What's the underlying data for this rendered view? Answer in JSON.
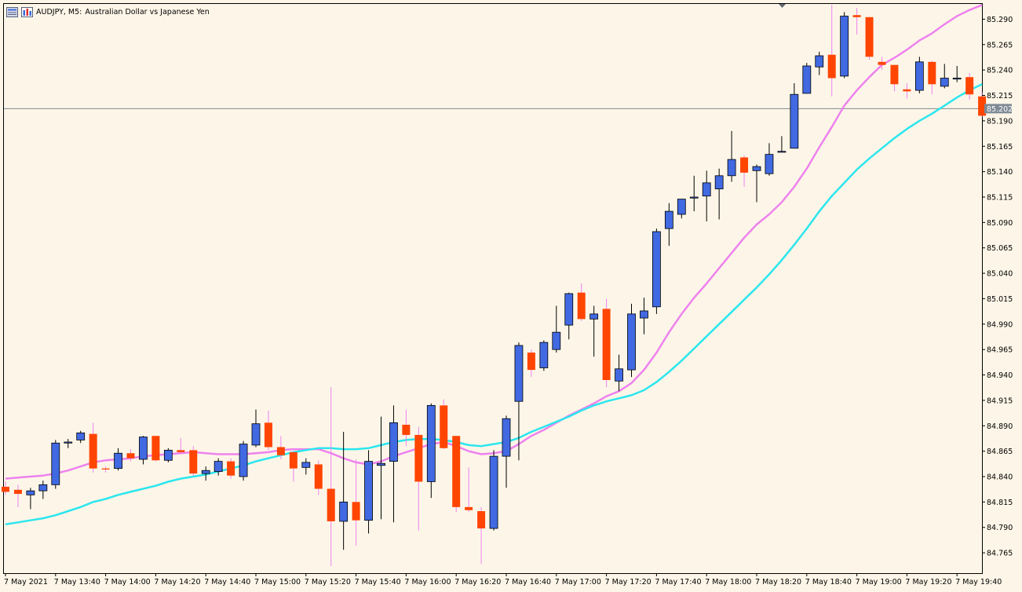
{
  "header": {
    "symbol_period": "AUDJPY, M5:",
    "description": "Australian Dollar vs Japanese Yen"
  },
  "price_line": {
    "value": 85.202,
    "label": "85.202"
  },
  "chart_data": {
    "type": "candlestick",
    "symbol": "AUDJPY",
    "timeframe": "M5",
    "title": "Australian Dollar vs Japanese Yen",
    "ylim": [
      84.745,
      85.305
    ],
    "y_ticks": [
      "85.290",
      "85.265",
      "85.240",
      "85.215",
      "85.190",
      "85.165",
      "85.140",
      "85.115",
      "85.090",
      "85.065",
      "85.040",
      "85.015",
      "84.990",
      "84.965",
      "84.940",
      "84.915",
      "84.890",
      "84.865",
      "84.840",
      "84.815",
      "84.790",
      "84.765"
    ],
    "x_ticks": [
      {
        "label": "7 May 2021",
        "i": 0
      },
      {
        "label": "7 May 13:40",
        "i": 4
      },
      {
        "label": "7 May 14:00",
        "i": 8
      },
      {
        "label": "7 May 14:20",
        "i": 12
      },
      {
        "label": "7 May 14:40",
        "i": 16
      },
      {
        "label": "7 May 15:00",
        "i": 20
      },
      {
        "label": "7 May 15:20",
        "i": 24
      },
      {
        "label": "7 May 15:40",
        "i": 28
      },
      {
        "label": "7 May 16:00",
        "i": 32
      },
      {
        "label": "7 May 16:20",
        "i": 36
      },
      {
        "label": "7 May 16:40",
        "i": 40
      },
      {
        "label": "7 May 17:00",
        "i": 44
      },
      {
        "label": "7 May 17:20",
        "i": 48
      },
      {
        "label": "7 May 17:40",
        "i": 52
      },
      {
        "label": "7 May 18:00",
        "i": 56
      },
      {
        "label": "7 May 18:20",
        "i": 60
      },
      {
        "label": "7 May 18:40",
        "i": 64
      },
      {
        "label": "7 May 19:00",
        "i": 68
      },
      {
        "label": "7 May 19:20",
        "i": 72
      },
      {
        "label": "7 May 19:40",
        "i": 76
      }
    ],
    "candles": [
      {
        "o": 84.83,
        "h": 84.835,
        "l": 84.822,
        "c": 84.825
      },
      {
        "o": 84.827,
        "h": 84.832,
        "l": 84.81,
        "c": 84.823
      },
      {
        "o": 84.822,
        "h": 84.829,
        "l": 84.808,
        "c": 84.826
      },
      {
        "o": 84.826,
        "h": 84.836,
        "l": 84.818,
        "c": 84.832
      },
      {
        "o": 84.832,
        "h": 84.876,
        "l": 84.828,
        "c": 84.873
      },
      {
        "o": 84.873,
        "h": 84.877,
        "l": 84.868,
        "c": 84.874
      },
      {
        "o": 84.876,
        "h": 84.885,
        "l": 84.873,
        "c": 84.883
      },
      {
        "o": 84.882,
        "h": 84.893,
        "l": 84.844,
        "c": 84.848
      },
      {
        "o": 84.848,
        "h": 84.85,
        "l": 84.844,
        "c": 84.847
      },
      {
        "o": 84.848,
        "h": 84.868,
        "l": 84.846,
        "c": 84.863
      },
      {
        "o": 84.863,
        "h": 84.867,
        "l": 84.855,
        "c": 84.858
      },
      {
        "o": 84.857,
        "h": 84.88,
        "l": 84.852,
        "c": 84.879
      },
      {
        "o": 84.88,
        "h": 84.88,
        "l": 84.855,
        "c": 84.856
      },
      {
        "o": 84.856,
        "h": 84.868,
        "l": 84.854,
        "c": 84.866
      },
      {
        "o": 84.866,
        "h": 84.878,
        "l": 84.862,
        "c": 84.864
      },
      {
        "o": 84.866,
        "h": 84.87,
        "l": 84.841,
        "c": 84.843
      },
      {
        "o": 84.843,
        "h": 84.85,
        "l": 84.836,
        "c": 84.846
      },
      {
        "o": 84.845,
        "h": 84.858,
        "l": 84.841,
        "c": 84.855
      },
      {
        "o": 84.855,
        "h": 84.858,
        "l": 84.838,
        "c": 84.841
      },
      {
        "o": 84.84,
        "h": 84.875,
        "l": 84.836,
        "c": 84.872
      },
      {
        "o": 84.871,
        "h": 84.906,
        "l": 84.869,
        "c": 84.892
      },
      {
        "o": 84.893,
        "h": 84.905,
        "l": 84.866,
        "c": 84.869
      },
      {
        "o": 84.869,
        "h": 84.88,
        "l": 84.857,
        "c": 84.861
      },
      {
        "o": 84.864,
        "h": 84.865,
        "l": 84.835,
        "c": 84.848
      },
      {
        "o": 84.849,
        "h": 84.858,
        "l": 84.842,
        "c": 84.854
      },
      {
        "o": 84.852,
        "h": 84.856,
        "l": 84.822,
        "c": 84.828
      },
      {
        "o": 84.828,
        "h": 84.928,
        "l": 84.752,
        "c": 84.796
      },
      {
        "o": 84.796,
        "h": 84.884,
        "l": 84.768,
        "c": 84.815
      },
      {
        "o": 84.815,
        "h": 84.857,
        "l": 84.772,
        "c": 84.797
      },
      {
        "o": 84.797,
        "h": 84.866,
        "l": 84.784,
        "c": 84.855
      },
      {
        "o": 84.851,
        "h": 84.899,
        "l": 84.798,
        "c": 84.853
      },
      {
        "o": 84.855,
        "h": 84.91,
        "l": 84.795,
        "c": 84.893
      },
      {
        "o": 84.891,
        "h": 84.906,
        "l": 84.87,
        "c": 84.881
      },
      {
        "o": 84.881,
        "h": 84.889,
        "l": 84.787,
        "c": 84.835
      },
      {
        "o": 84.835,
        "h": 84.912,
        "l": 84.819,
        "c": 84.91
      },
      {
        "o": 84.91,
        "h": 84.916,
        "l": 84.867,
        "c": 84.868
      },
      {
        "o": 84.88,
        "h": 84.88,
        "l": 84.805,
        "c": 84.81
      },
      {
        "o": 84.81,
        "h": 84.849,
        "l": 84.805,
        "c": 84.807
      },
      {
        "o": 84.806,
        "h": 84.81,
        "l": 84.754,
        "c": 84.789
      },
      {
        "o": 84.789,
        "h": 84.866,
        "l": 84.787,
        "c": 84.86
      },
      {
        "o": 84.86,
        "h": 84.9,
        "l": 84.829,
        "c": 84.897
      },
      {
        "o": 84.914,
        "h": 84.972,
        "l": 84.856,
        "c": 84.969
      },
      {
        "o": 84.962,
        "h": 84.965,
        "l": 84.938,
        "c": 84.945
      },
      {
        "o": 84.947,
        "h": 84.974,
        "l": 84.944,
        "c": 84.972
      },
      {
        "o": 84.965,
        "h": 85.008,
        "l": 84.962,
        "c": 84.982
      },
      {
        "o": 84.989,
        "h": 85.021,
        "l": 84.975,
        "c": 85.02
      },
      {
        "o": 85.021,
        "h": 85.03,
        "l": 84.993,
        "c": 84.995
      },
      {
        "o": 84.995,
        "h": 85.008,
        "l": 84.958,
        "c": 85.0
      },
      {
        "o": 85.005,
        "h": 85.015,
        "l": 84.928,
        "c": 84.935
      },
      {
        "o": 84.934,
        "h": 84.96,
        "l": 84.924,
        "c": 84.946
      },
      {
        "o": 84.945,
        "h": 85.01,
        "l": 84.938,
        "c": 85.0
      },
      {
        "o": 84.996,
        "h": 85.016,
        "l": 84.98,
        "c": 85.003
      },
      {
        "o": 85.007,
        "h": 85.084,
        "l": 85.0,
        "c": 85.081
      },
      {
        "o": 85.084,
        "h": 85.109,
        "l": 85.067,
        "c": 85.101
      },
      {
        "o": 85.098,
        "h": 85.113,
        "l": 85.094,
        "c": 85.113
      },
      {
        "o": 85.114,
        "h": 85.136,
        "l": 85.101,
        "c": 85.115
      },
      {
        "o": 85.116,
        "h": 85.141,
        "l": 85.091,
        "c": 85.129
      },
      {
        "o": 85.123,
        "h": 85.143,
        "l": 85.093,
        "c": 85.136
      },
      {
        "o": 85.136,
        "h": 85.18,
        "l": 85.13,
        "c": 85.152
      },
      {
        "o": 85.154,
        "h": 85.156,
        "l": 85.125,
        "c": 85.139
      },
      {
        "o": 85.141,
        "h": 85.147,
        "l": 85.11,
        "c": 85.145
      },
      {
        "o": 85.138,
        "h": 85.168,
        "l": 85.136,
        "c": 85.157
      },
      {
        "o": 85.16,
        "h": 85.175,
        "l": 85.16,
        "c": 85.16
      },
      {
        "o": 85.163,
        "h": 85.227,
        "l": 85.163,
        "c": 85.216
      },
      {
        "o": 85.217,
        "h": 85.247,
        "l": 85.217,
        "c": 85.244
      },
      {
        "o": 85.243,
        "h": 85.258,
        "l": 85.235,
        "c": 85.254
      },
      {
        "o": 85.255,
        "h": 85.304,
        "l": 85.214,
        "c": 85.232
      },
      {
        "o": 85.234,
        "h": 85.297,
        "l": 85.232,
        "c": 85.293
      },
      {
        "o": 85.294,
        "h": 85.301,
        "l": 85.275,
        "c": 85.292
      },
      {
        "o": 85.292,
        "h": 85.292,
        "l": 85.25,
        "c": 85.253
      },
      {
        "o": 85.248,
        "h": 85.253,
        "l": 85.24,
        "c": 85.245
      },
      {
        "o": 85.245,
        "h": 85.245,
        "l": 85.219,
        "c": 85.226
      },
      {
        "o": 85.221,
        "h": 85.227,
        "l": 85.212,
        "c": 85.219
      },
      {
        "o": 85.22,
        "h": 85.253,
        "l": 85.217,
        "c": 85.248
      },
      {
        "o": 85.248,
        "h": 85.249,
        "l": 85.216,
        "c": 85.226
      },
      {
        "o": 85.224,
        "h": 85.246,
        "l": 85.222,
        "c": 85.232
      },
      {
        "o": 85.232,
        "h": 85.244,
        "l": 85.228,
        "c": 85.232
      },
      {
        "o": 85.233,
        "h": 85.237,
        "l": 85.211,
        "c": 85.216
      },
      {
        "o": 85.214,
        "h": 85.218,
        "l": 85.194,
        "c": 85.195
      }
    ],
    "series": [
      {
        "name": "",
        "color": "#ee82ee",
        "values": [
          84.838,
          84.839,
          84.84,
          84.841,
          84.843,
          84.846,
          84.85,
          84.854,
          84.856,
          84.857,
          84.858,
          84.86,
          84.861,
          84.862,
          84.863,
          84.864,
          84.863,
          84.862,
          84.862,
          84.862,
          84.863,
          84.864,
          84.866,
          84.867,
          84.867,
          84.867,
          84.863,
          84.858,
          84.854,
          84.852,
          84.855,
          84.86,
          84.864,
          84.868,
          84.872,
          84.874,
          84.87,
          84.865,
          84.862,
          84.863,
          84.865,
          84.872,
          84.88,
          84.886,
          84.893,
          84.9,
          84.906,
          84.912,
          84.919,
          84.924,
          84.932,
          84.945,
          84.962,
          84.982,
          85.0,
          85.016,
          85.03,
          85.045,
          85.06,
          85.075,
          85.088,
          85.098,
          85.11,
          85.125,
          85.143,
          85.164,
          85.184,
          85.205,
          85.22,
          85.233,
          85.245,
          85.252,
          85.26,
          85.269,
          85.276,
          85.285,
          85.293,
          85.299,
          85.304
        ]
      },
      {
        "name": "",
        "color": "#2be6ee",
        "values": [
          84.793,
          84.795,
          84.797,
          84.799,
          84.802,
          84.806,
          84.81,
          84.815,
          84.818,
          84.822,
          84.825,
          84.828,
          84.831,
          84.835,
          84.838,
          84.84,
          84.842,
          84.845,
          84.848,
          84.851,
          84.855,
          84.858,
          84.861,
          84.864,
          84.866,
          84.868,
          84.868,
          84.867,
          84.867,
          84.868,
          84.871,
          84.874,
          84.876,
          84.877,
          84.877,
          84.876,
          84.874,
          84.871,
          84.87,
          84.872,
          84.874,
          84.878,
          84.884,
          84.889,
          84.894,
          84.899,
          84.905,
          84.91,
          84.914,
          84.917,
          84.92,
          84.925,
          84.933,
          84.943,
          84.954,
          84.966,
          84.978,
          84.99,
          85.002,
          85.014,
          85.026,
          85.039,
          85.053,
          85.068,
          85.084,
          85.101,
          85.116,
          85.129,
          85.142,
          85.153,
          85.163,
          85.173,
          85.182,
          85.19,
          85.197,
          85.205,
          85.213,
          85.22,
          85.226
        ]
      }
    ]
  }
}
